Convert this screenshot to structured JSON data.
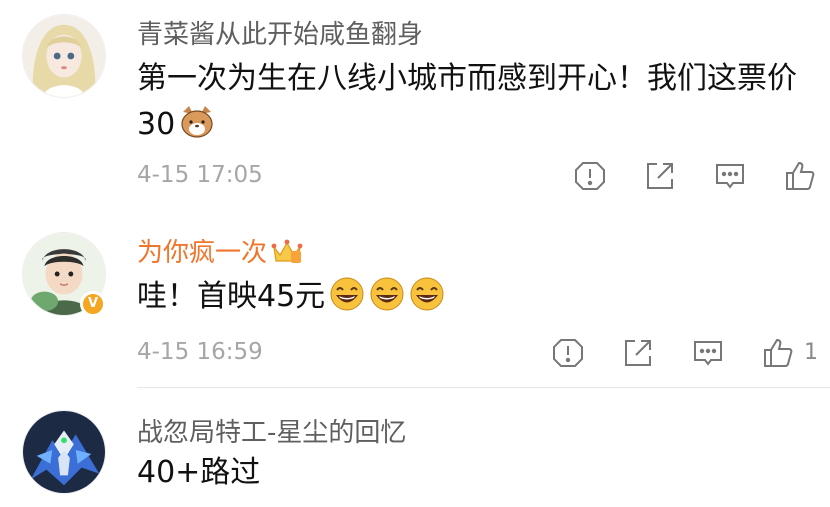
{
  "comments": [
    {
      "username": "青菜酱从此开始咸鱼翻身",
      "text": "第一次为生在八线小城市而感到开心！我们这票价30",
      "emoji": "cat-face-emoji",
      "time": "4-15 17:05",
      "likes": ""
    },
    {
      "username": "为你疯一次",
      "text": "哇！首映45元",
      "emoji": "grinning-face-emoji",
      "emoji_count": 3,
      "time": "4-15 16:59",
      "likes": "1",
      "verified": "V"
    },
    {
      "username": "战忽局特工-星尘的回忆",
      "text": "40+路过"
    }
  ],
  "colors": {
    "vip_name": "#f0762c",
    "username": "#5f5f5f",
    "time": "#a6a6a6",
    "badge": "#f5a623"
  },
  "icons": [
    "report-icon",
    "share-icon",
    "reply-icon",
    "like-icon"
  ]
}
